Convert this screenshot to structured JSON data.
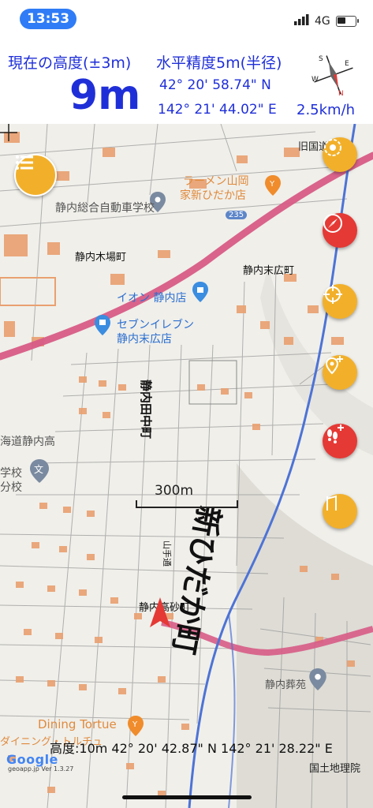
{
  "status_bar": {
    "time": "13:53",
    "network": "4G"
  },
  "header": {
    "altitude_label": "現在の高度(±3m)",
    "accuracy_label": "水平精度5m(半径)",
    "altitude_value": "9m",
    "latitude": "42° 20' 58.74\" N",
    "longitude": "142° 21' 44.02\" E",
    "speed": "2.5km/h",
    "compass_letters": {
      "north": "N",
      "south": "S",
      "east": "E",
      "west": "W"
    }
  },
  "map": {
    "labels": {
      "old_road": "旧国道",
      "ramen": "ラーメン山岡",
      "ramen2": "家新ひだか店",
      "driving_school": "静内総合自動車学校",
      "route_235": "235",
      "kiba": "静内木場町",
      "suehiro_cho": "静内末広町",
      "aeon": "イオン 静内店",
      "seven1": "セブンイレブン",
      "seven2": "静内末広店",
      "koyo_cho": "静内田中町",
      "high_school": "海道静内高",
      "school2": "学校",
      "school3": "分校",
      "shin_hidaka": "新ひだか町",
      "takasago": "静内高砂町",
      "yamate": "山手通",
      "funeral": "静内葬苑",
      "dining": "Dining Tortue",
      "dining2": "ダイニング・トルチュ",
      "bun": "文"
    },
    "scale_label": "300m",
    "bottom_info": "高度:10m  42° 20' 42.87\" N 142° 21' 28.22\" E",
    "attribution_google": "Google",
    "attribution_sub": "geoapp.jp Ver 1.3.27",
    "attribution_gsi": "国土地理院"
  },
  "buttons": {
    "menu": "menu-icon",
    "layers": "layers-icon",
    "compass": "compass-icon",
    "target": "target-icon",
    "add_place": "add-place-icon",
    "add_track": "add-track-icon",
    "route": "route-icon"
  },
  "colors": {
    "accent_blue": "#1f2fd8",
    "fab_gold": "#f2b02a",
    "fab_red": "#e53935",
    "route_pink": "#d75b86",
    "building_orange": "#e9a070"
  }
}
